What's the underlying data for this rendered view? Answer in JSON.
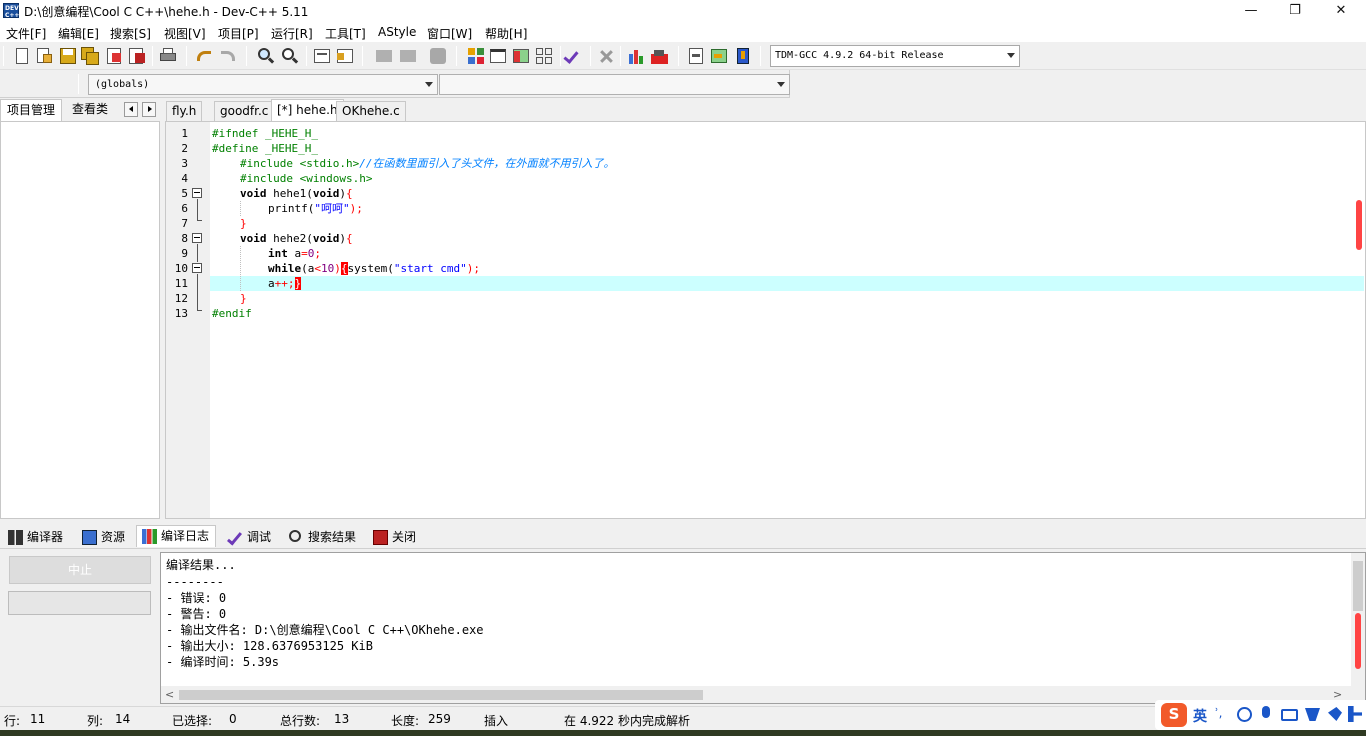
{
  "window": {
    "title": "D:\\创意编程\\Cool C C++\\hehe.h - Dev-C++ 5.11",
    "app_icon_text": "DEV C++",
    "minimize": "—",
    "maximize": "❐",
    "close": "✕"
  },
  "menu": [
    "文件[F]",
    "编辑[E]",
    "搜索[S]",
    "视图[V]",
    "项目[P]",
    "运行[R]",
    "工具[T]",
    "AStyle",
    "窗口[W]",
    "帮助[H]"
  ],
  "toolbar": {
    "compiler": "TDM-GCC 4.9.2 64-bit Release"
  },
  "classbar": {
    "scope": "(globals)",
    "member": ""
  },
  "left_panel": {
    "tabs": [
      "项目管理",
      "查看类"
    ]
  },
  "editor": {
    "tabs": [
      "fly.h",
      "goodfr.c",
      "[*] hehe.h",
      "OKhehe.c"
    ],
    "active_tab": 2,
    "line_numbers": [
      "1",
      "2",
      "3",
      "4",
      "5",
      "6",
      "7",
      "8",
      "9",
      "10",
      "11",
      "12",
      "13"
    ],
    "lines": {
      "l1": "#ifndef _HEHE_H_",
      "l2": "#define _HEHE_H_",
      "l3_code": "#include <stdio.h>",
      "l3_comment": "//在函数里面引入了头文件，在外面就不用引入了。",
      "l4": "#include <windows.h>",
      "l5_kw": "void",
      "l5_name": " hehe1(",
      "l5_kw2": "void",
      "l5_close": ")",
      "l5_brace": "{",
      "l6_call": "printf(",
      "l6_str": "\"呵呵\"",
      "l6_end": ");",
      "l7": "}",
      "l8_kw": "void",
      "l8_name": " hehe2(",
      "l8_kw2": "void",
      "l8_close": ")",
      "l8_brace": "{",
      "l9_kw": "int",
      "l9_var": " a",
      "l9_eq": "=",
      "l9_num": "0",
      "l9_semi": ";",
      "l10_kw": "while",
      "l10_open": "(a",
      "l10_lt": "<",
      "l10_num": "10",
      "l10_close": ")",
      "l10_brace": "{",
      "l10_call": "system(",
      "l10_str": "\"start cmd\"",
      "l10_end": ");",
      "l11_var": "a",
      "l11_op": "++;",
      "l11_brace": "}",
      "l12": "}",
      "l13": "#endif"
    }
  },
  "bottom_tabs": [
    "编译器",
    "资源",
    "编译日志",
    "调试",
    "搜索结果",
    "关闭"
  ],
  "bottom_active_tab": 2,
  "abort_button": "中止",
  "compile_log": [
    "编译结果...",
    "--------",
    "- 错误: 0",
    "- 警告: 0",
    "- 输出文件名: D:\\创意编程\\Cool C C++\\OKhehe.exe",
    "- 输出大小: 128.6376953125 KiB",
    "- 编译时间: 5.39s"
  ],
  "status": {
    "row_label": "行:",
    "row": "11",
    "col_label": "列:",
    "col": "14",
    "sel_label": "已选择:",
    "sel": "0",
    "total_label": "总行数:",
    "total": "13",
    "len_label": "长度:",
    "len": "259",
    "mode": "插入",
    "parse": "在 4.922 秒内完成解析"
  },
  "ime": {
    "lang": "英",
    "punct": "ʾ,"
  },
  "colors": {
    "preprocessor": "#008000",
    "string": "#0000ff",
    "comment": "#0080ff",
    "symbol": "#ff0000",
    "number": "#800080",
    "current_line": "#ccffff"
  }
}
